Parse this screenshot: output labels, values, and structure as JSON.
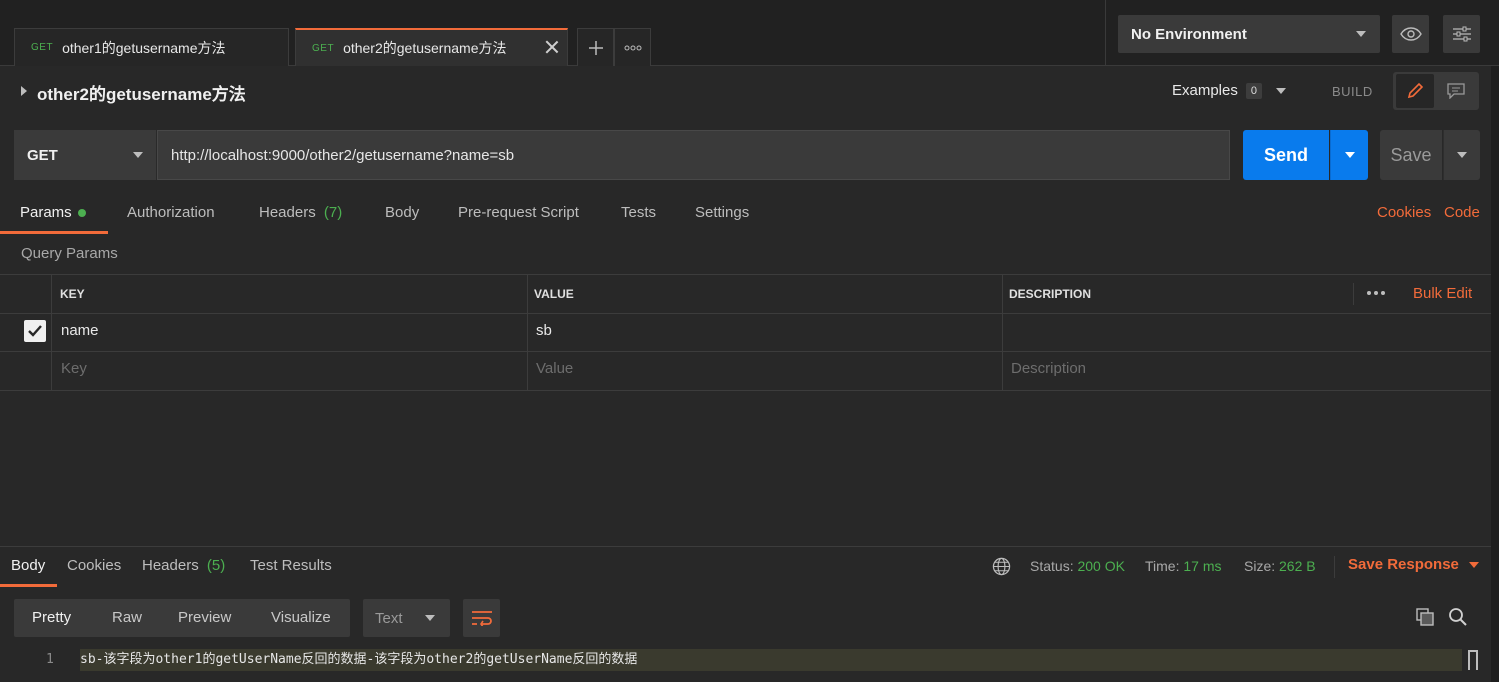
{
  "tabs": [
    {
      "method": "GET",
      "label": "other1的getusername方法",
      "active": false
    },
    {
      "method": "GET",
      "label": "other2的getusername方法",
      "active": true
    }
  ],
  "environment": {
    "selected": "No Environment"
  },
  "request": {
    "title": "other2的getusername方法",
    "examples_label": "Examples",
    "examples_count": "0",
    "build_label": "BUILD",
    "method": "GET",
    "url": "http://localhost:9000/other2/getusername?name=sb",
    "send_label": "Send",
    "save_label": "Save"
  },
  "request_tabs": {
    "params": "Params",
    "authorization": "Authorization",
    "headers": "Headers",
    "headers_count": "(7)",
    "body": "Body",
    "prerequest": "Pre-request Script",
    "tests": "Tests",
    "settings": "Settings",
    "cookies": "Cookies",
    "code": "Code"
  },
  "query_params": {
    "label": "Query Params",
    "columns": {
      "key": "KEY",
      "value": "VALUE",
      "description": "DESCRIPTION"
    },
    "bulk_edit": "Bulk Edit",
    "rows": [
      {
        "checked": true,
        "key": "name",
        "value": "sb",
        "description": ""
      }
    ],
    "placeholders": {
      "key": "Key",
      "value": "Value",
      "description": "Description"
    }
  },
  "response": {
    "tabs": {
      "body": "Body",
      "cookies": "Cookies",
      "headers": "Headers",
      "headers_count": "(5)",
      "test_results": "Test Results"
    },
    "status_label": "Status:",
    "status_value": "200 OK",
    "time_label": "Time:",
    "time_value": "17 ms",
    "size_label": "Size:",
    "size_value": "262 B",
    "save_response": "Save Response",
    "formats": {
      "pretty": "Pretty",
      "raw": "Raw",
      "preview": "Preview",
      "visualize": "Visualize"
    },
    "language": "Text",
    "line_number": "1",
    "body_text": "sb-该字段为other1的getUserName反回的数据-该字段为other2的getUserName反回的数据"
  },
  "colors": {
    "accent": "#f26b3a",
    "send": "#097bed",
    "success": "#4caf50"
  }
}
